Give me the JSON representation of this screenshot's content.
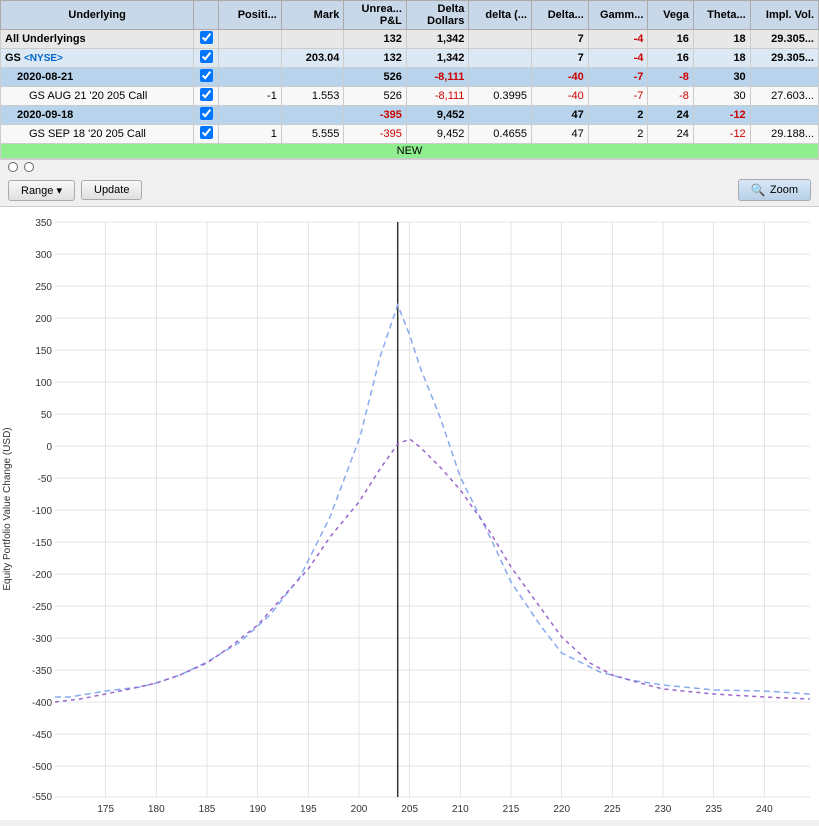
{
  "table": {
    "headers": [
      "Underlying",
      "",
      "Positi...",
      "Mark",
      "Unrea... P&L",
      "Delta Dollars",
      "delta (...",
      "Delta...",
      "Gamm...",
      "Vega",
      "Theta...",
      "Impl. Vol."
    ],
    "rows": [
      {
        "type": "all",
        "label": "All Underlyings",
        "check": true,
        "position": "",
        "mark": "",
        "unrealized": "132",
        "delta_dollars": "1,342",
        "delta_pct": "",
        "delta": "7",
        "gamma": "-4",
        "vega": "16",
        "theta": "18",
        "impl_vol": "29.305..."
      },
      {
        "type": "gs",
        "label": "GS",
        "exchange": "<NYSE>",
        "check": true,
        "position": "",
        "mark": "203.04",
        "unrealized": "132",
        "delta_dollars": "1,342",
        "delta_pct": "",
        "delta": "7",
        "gamma": "-4",
        "vega": "16",
        "theta": "18",
        "impl_vol": "29.305..."
      },
      {
        "type": "date1",
        "label": "2020-08-21",
        "check": true,
        "position": "",
        "mark": "",
        "unrealized": "526",
        "delta_dollars": "-8,111",
        "delta_pct": "",
        "delta": "-40",
        "gamma": "-7",
        "vega": "-8",
        "theta": "30",
        "impl_vol": ""
      },
      {
        "type": "option1",
        "label": "GS AUG 21 '20 205 Call",
        "check": true,
        "position": "-1",
        "mark": "1.553",
        "unrealized": "526",
        "delta_dollars": "-8,111",
        "delta_pct": "0.3995",
        "delta": "-40",
        "gamma": "-7",
        "vega": "-8",
        "theta": "30",
        "impl_vol": "27.603..."
      },
      {
        "type": "date2",
        "label": "2020-09-18",
        "check": true,
        "position": "",
        "mark": "",
        "unrealized": "-395",
        "delta_dollars": "9,452",
        "delta_pct": "",
        "delta": "47",
        "gamma": "2",
        "vega": "24",
        "theta": "-12",
        "impl_vol": ""
      },
      {
        "type": "option2",
        "label": "GS SEP 18 '20 205 Call",
        "check": true,
        "position": "1",
        "mark": "5.555",
        "unrealized": "-395",
        "delta_dollars": "9,452",
        "delta_pct": "0.4655",
        "delta": "47",
        "gamma": "2",
        "vega": "24",
        "theta": "-12",
        "impl_vol": "29.188..."
      },
      {
        "type": "new",
        "label": "NEW"
      }
    ]
  },
  "controls": {
    "range_label": "Range",
    "update_label": "Update",
    "zoom_label": "Zoom"
  },
  "chart": {
    "y_axis_label": "Equity Portfolio Value Change (USD)",
    "y_ticks": [
      "350",
      "300",
      "250",
      "200",
      "150",
      "100",
      "50",
      "0",
      "-50",
      "-100",
      "-150",
      "-200",
      "-250",
      "-300",
      "-350",
      "-400",
      "-450",
      "-500",
      "-550"
    ],
    "x_ticks": [
      "175",
      "180",
      "185",
      "190",
      "195",
      "200",
      "205",
      "210",
      "215",
      "220",
      "225",
      "230",
      "235",
      "240"
    ],
    "vertical_line_x": 204
  }
}
